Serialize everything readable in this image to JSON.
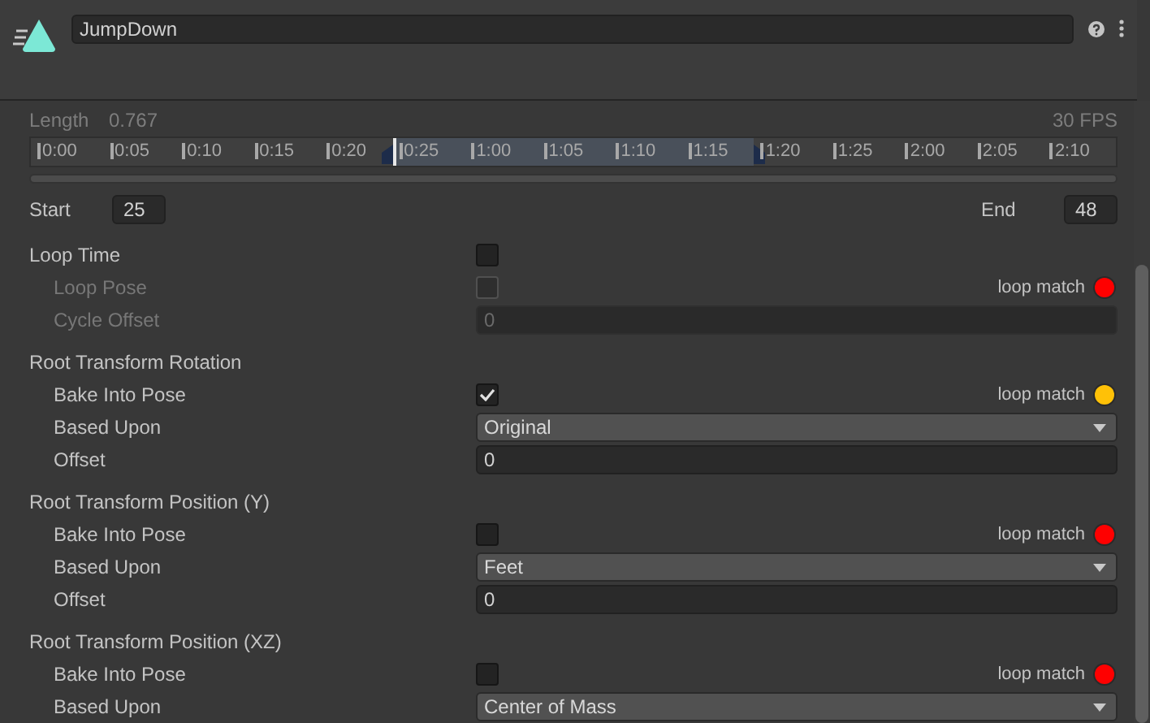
{
  "clip": {
    "name": "JumpDown"
  },
  "length": {
    "label": "Length",
    "value": "0.767",
    "fps": "30 FPS"
  },
  "timeline": {
    "ticks": [
      {
        "label": "0:00",
        "selected": false
      },
      {
        "label": "0:05",
        "selected": false
      },
      {
        "label": "0:10",
        "selected": false
      },
      {
        "label": "0:15",
        "selected": false
      },
      {
        "label": "0:20",
        "selected": false
      },
      {
        "label": "0:25",
        "selected": true
      },
      {
        "label": "1:00",
        "selected": true
      },
      {
        "label": "1:05",
        "selected": true
      },
      {
        "label": "1:10",
        "selected": true
      },
      {
        "label": "1:15",
        "selected": true
      },
      {
        "label": "1:20",
        "selected": false
      },
      {
        "label": "1:25",
        "selected": false
      },
      {
        "label": "2:00",
        "selected": false
      },
      {
        "label": "2:05",
        "selected": false
      },
      {
        "label": "2:10",
        "selected": false
      }
    ]
  },
  "range": {
    "start_label": "Start",
    "start": "25",
    "end_label": "End",
    "end": "48"
  },
  "groups": [
    {
      "label": "Loop Time",
      "kind": "checkbox",
      "checked": false,
      "children": [
        {
          "label": "Loop Pose",
          "kind": "checkbox",
          "checked": false,
          "disabled": true,
          "loop_match": {
            "label": "loop match",
            "color": "#ff0000"
          }
        },
        {
          "label": "Cycle Offset",
          "kind": "number",
          "value": "0",
          "disabled": true
        }
      ]
    },
    {
      "label": "Root Transform Rotation",
      "kind": "heading",
      "children": [
        {
          "label": "Bake Into Pose",
          "kind": "checkbox",
          "checked": true,
          "disabled": false,
          "loop_match": {
            "label": "loop match",
            "color": "#ffc107"
          }
        },
        {
          "label": "Based Upon",
          "kind": "dropdown",
          "value": "Original",
          "disabled": false
        },
        {
          "label": "Offset",
          "kind": "number",
          "value": "0",
          "disabled": false
        }
      ]
    },
    {
      "label": "Root Transform Position (Y)",
      "kind": "heading",
      "children": [
        {
          "label": "Bake Into Pose",
          "kind": "checkbox",
          "checked": false,
          "disabled": false,
          "loop_match": {
            "label": "loop match",
            "color": "#ff0000"
          }
        },
        {
          "label": "Based Upon",
          "kind": "dropdown",
          "value": "Feet",
          "disabled": false
        },
        {
          "label": "Offset",
          "kind": "number",
          "value": "0",
          "disabled": false
        }
      ]
    },
    {
      "label": "Root Transform Position (XZ)",
      "kind": "heading",
      "children": [
        {
          "label": "Bake Into Pose",
          "kind": "checkbox",
          "checked": false,
          "disabled": false,
          "loop_match": {
            "label": "loop match",
            "color": "#ff0000"
          }
        },
        {
          "label": "Based Upon",
          "kind": "dropdown",
          "value": "Center of Mass",
          "disabled": false
        }
      ]
    }
  ]
}
